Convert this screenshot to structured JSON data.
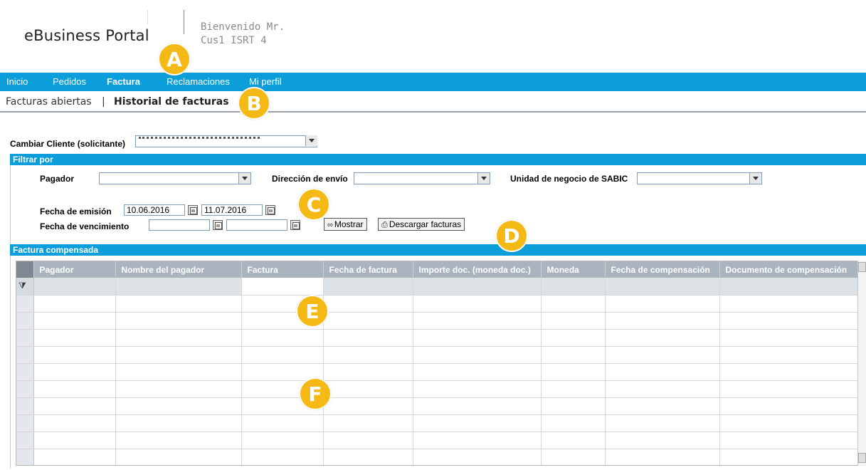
{
  "header": {
    "logo": "eBusiness Portal",
    "welcome_line1": "Bienvenido Mr.",
    "welcome_line2": "Cus1 ISRT 4"
  },
  "topnav": {
    "items": [
      {
        "label": "Inicio",
        "active": false
      },
      {
        "label": "Pedidos",
        "active": false
      },
      {
        "label": "Factura",
        "active": true
      },
      {
        "label": "Reclamaciones",
        "active": false
      },
      {
        "label": "Mi perfil",
        "active": false
      }
    ]
  },
  "subnav": {
    "items": [
      {
        "label": "Facturas abiertas",
        "active": false
      },
      {
        "label": "Historial de facturas",
        "active": true
      }
    ],
    "separator": "|"
  },
  "cliente": {
    "label": "Cambiar Cliente (solicitante)"
  },
  "filter": {
    "title": "Filtrar por",
    "pagador_label": "Pagador",
    "direccion_label": "Dirección de envío",
    "unidad_label": "Unidad de negocio de SABIC",
    "emision_label": "Fecha de emisión",
    "emision_from": "10.06.2016",
    "emision_to": "11.07.2016",
    "vencimiento_label": "Fecha de vencimiento",
    "vencimiento_from": "",
    "vencimiento_to": "",
    "mostrar_button": "Mostrar",
    "descargar_button": "Descargar facturas"
  },
  "results": {
    "title": "Factura compensada",
    "columns": [
      "Pagador",
      "Nombre del pagador",
      "Factura",
      "Fecha de factura",
      "Importe doc. (moneda doc.)",
      "Moneda",
      "Fecha de compensación",
      "Documento de compensación"
    ],
    "empty_rows": 10
  },
  "markers": [
    "A",
    "B",
    "C",
    "D",
    "E",
    "F"
  ],
  "colors": {
    "nav_blue": "#0c9edb",
    "grid_header": "#a9b4bf",
    "marker": "#f5b916"
  }
}
